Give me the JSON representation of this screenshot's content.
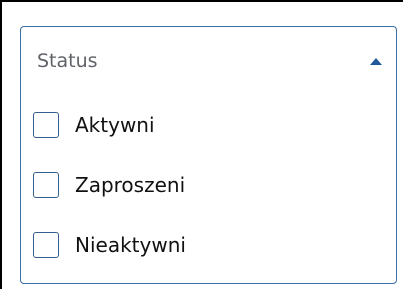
{
  "filter": {
    "title": "Status",
    "expanded_icon": "caret-up-icon",
    "options": [
      {
        "label": "Aktywni",
        "checked": false
      },
      {
        "label": "Zaproszeni",
        "checked": false
      },
      {
        "label": "Nieaktywni",
        "checked": false
      }
    ]
  },
  "colors": {
    "accent": "#3b6ea5",
    "caret": "#1f5a9b",
    "checkbox_border": "#355f8f",
    "label_muted": "#5f6368"
  }
}
